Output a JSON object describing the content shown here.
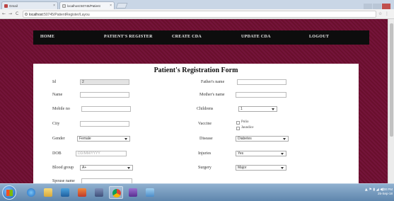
{
  "browser": {
    "tabs": [
      {
        "title": "Gmail"
      },
      {
        "title": "localhost:50745/Patient"
      }
    ],
    "address": {
      "scheme": "localhost",
      "path": ":50745/PatientRegister/Layou"
    }
  },
  "nav": {
    "items": [
      "HOME",
      "PATIENT'S REGISTER",
      "CREATE CDA",
      "UPDATE CDA",
      "LOGOUT"
    ]
  },
  "form": {
    "title": "Patient's Registration Form",
    "id_label": "Id",
    "id_value": "2",
    "name_label": "Name",
    "name_value": "",
    "mobile_label": "Mobile no",
    "mobile_value": "",
    "city_label": "City",
    "city_value": "",
    "gender_label": "Gender",
    "gender_value": "Female",
    "dob_label": "DOB",
    "dob_placeholder": "DD/MM/YYYY",
    "blood_label": "Blood group",
    "blood_value": "A+",
    "spouse_label": "Spouse name",
    "spouse_value": "",
    "father_label": "Father's name",
    "father_value": "",
    "mother_label": "Mother's name",
    "mother_value": "",
    "childrens_label": "Childrens",
    "childrens_value": "1",
    "vaccine_label": "Vaccine",
    "vaccine_options": [
      "Polio",
      "Jaundice"
    ],
    "disease_label": "Disease",
    "disease_value": "Diabetes",
    "injuries_label": "Injuries",
    "injuries_value": "Yes",
    "surgery_label": "Surgery",
    "surgery_value": "Major"
  },
  "taskbar": {
    "time": "9:00 PM",
    "date": "25-Sep-18"
  },
  "colors": {
    "page_bg": "#6b0f2e",
    "nav_bg": "#0d0d0d"
  }
}
